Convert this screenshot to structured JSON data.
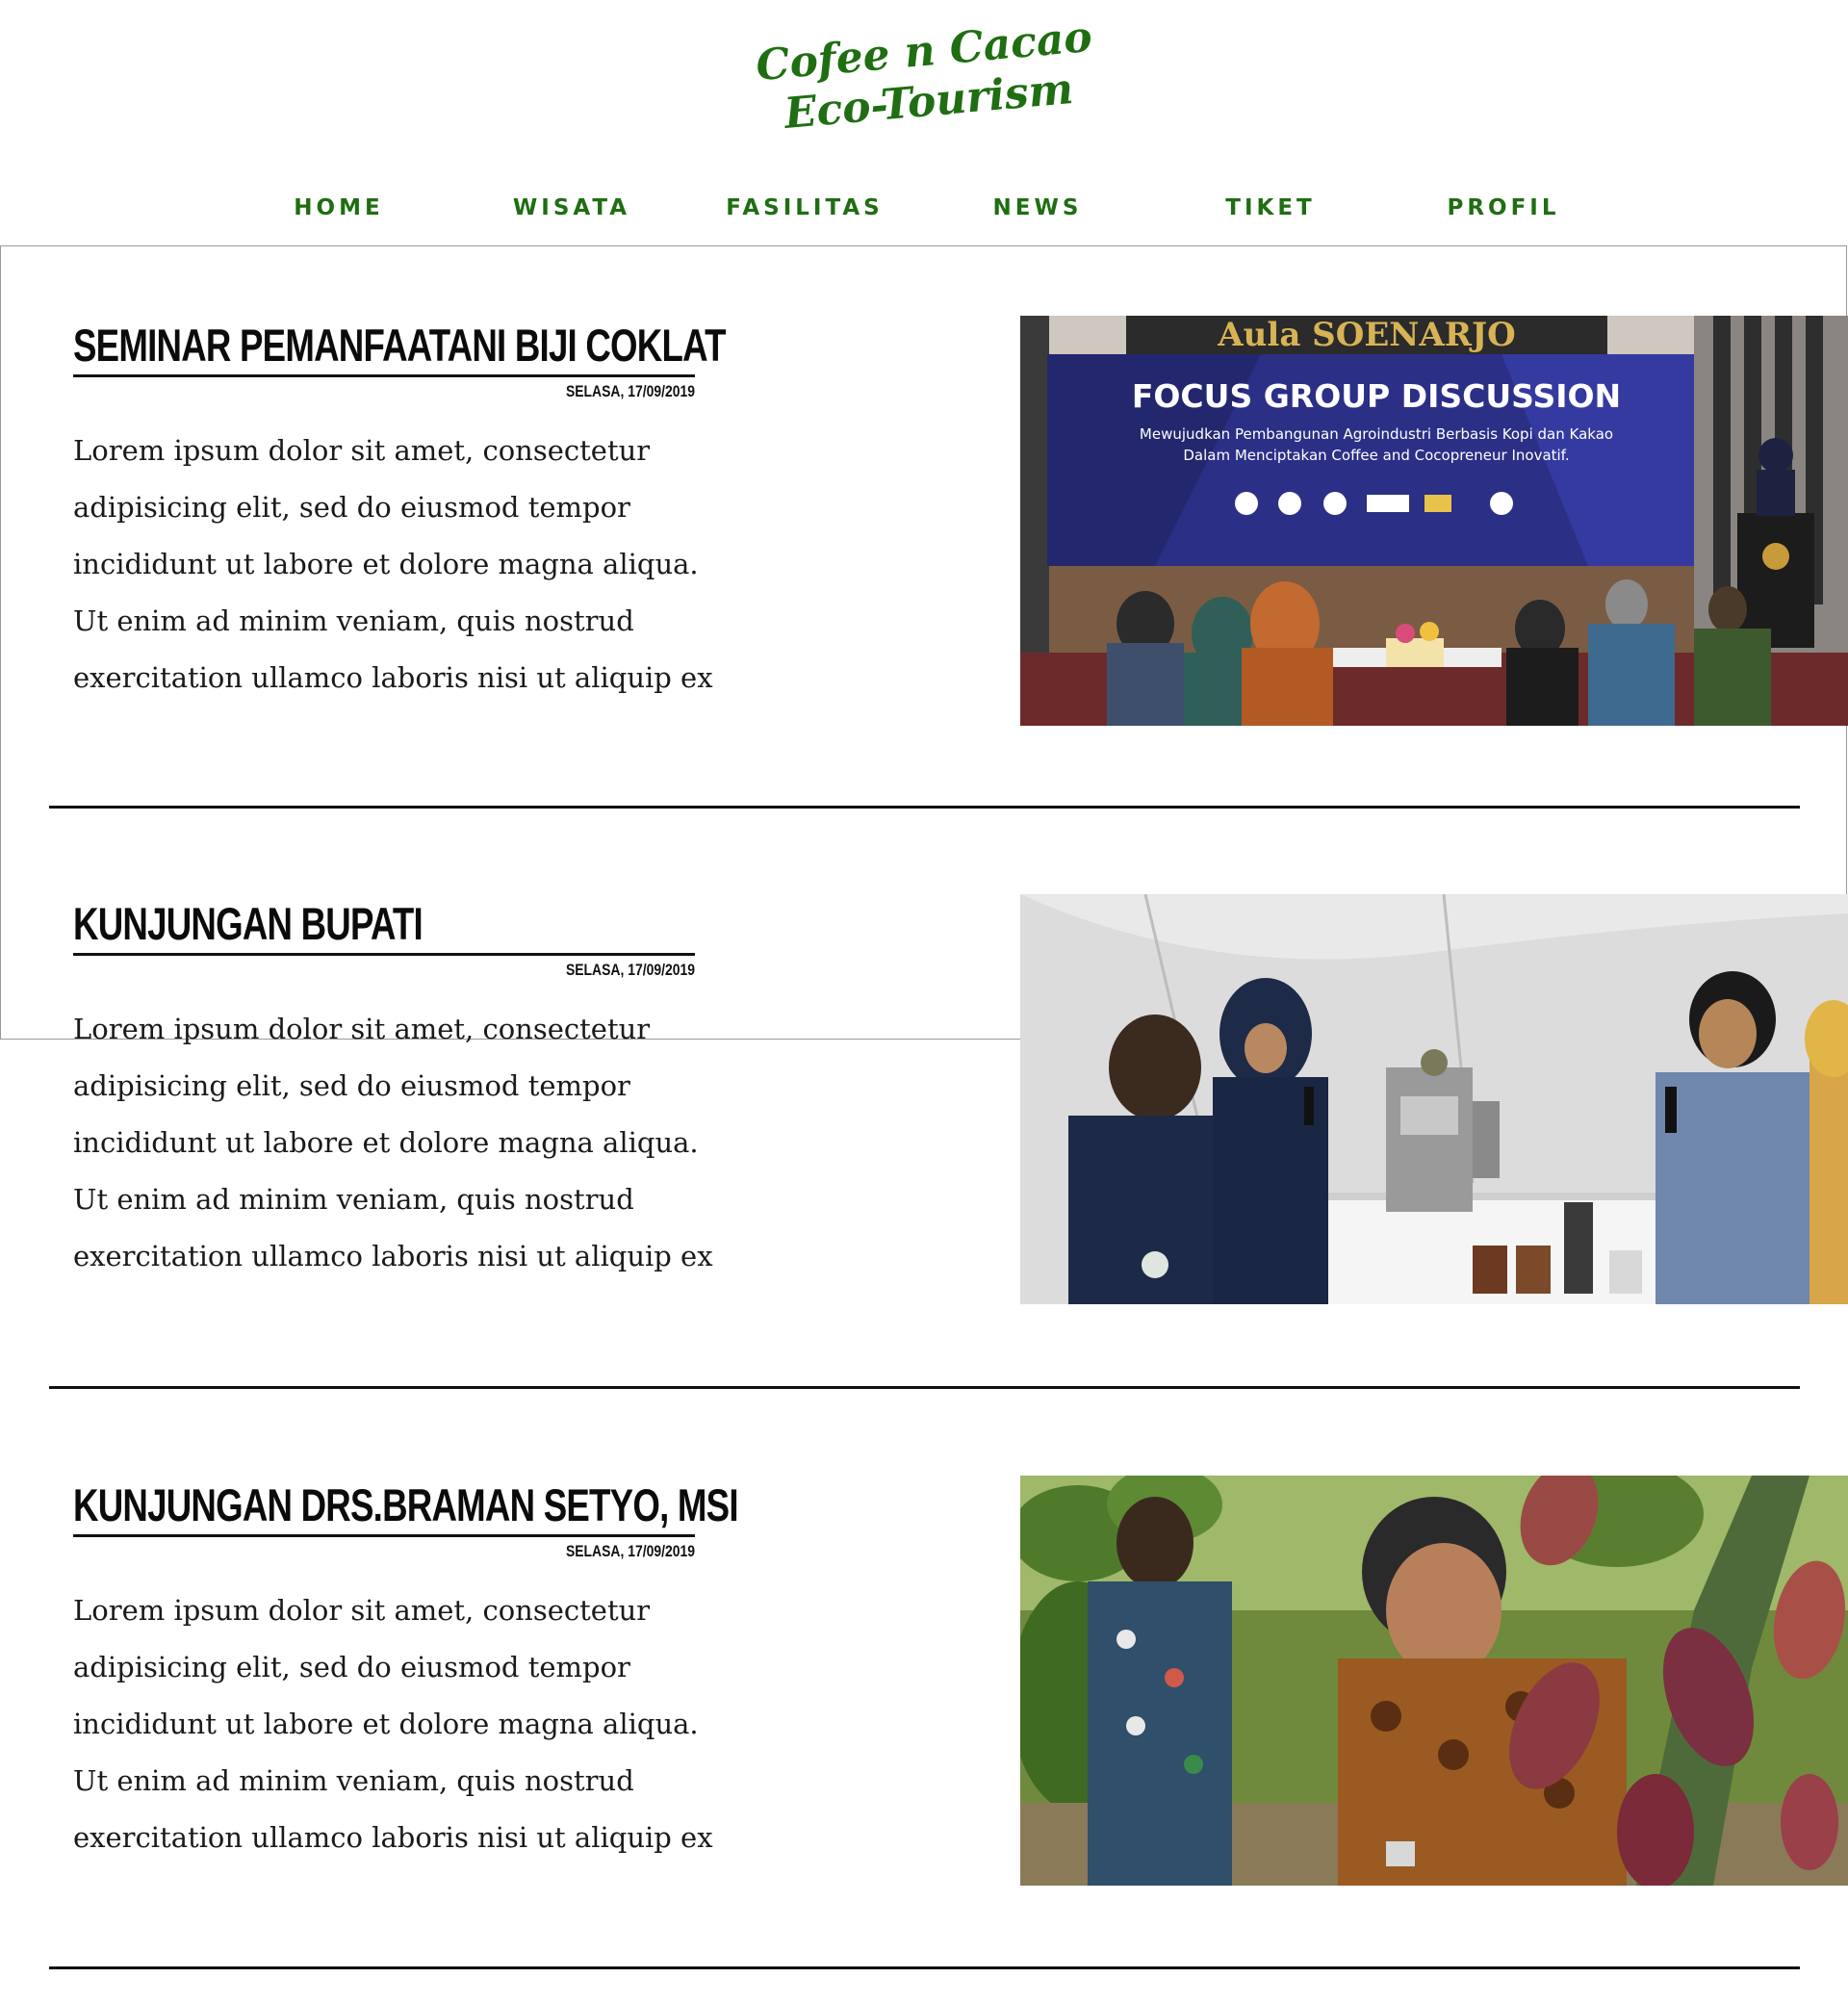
{
  "brand": {
    "line1": "Cofee n Cacao",
    "line2": "Eco-Tourism"
  },
  "nav": [
    {
      "label": "HOME"
    },
    {
      "label": "WISATA"
    },
    {
      "label": "FASILITAS"
    },
    {
      "label": "NEWS"
    },
    {
      "label": "TIKET"
    },
    {
      "label": "PROFIL"
    }
  ],
  "articles": [
    {
      "title": "SEMINAR PEMANFAATANI BIJI COKLAT",
      "date": "SELASA, 17/09/2019",
      "body": [
        "Lorem ipsum dolor sit amet, consectetur",
        "adipisicing elit, sed do eiusmod tempor",
        "incididunt ut labore et dolore magna aliqua.",
        "Ut enim ad minim veniam, quis nostrud",
        "exercitation ullamco laboris nisi ut aliquip ex"
      ],
      "photo": {
        "hall_sign": "Aula SOENARJO",
        "banner_title": "FOCUS GROUP DISCUSSION",
        "banner_sub1": "Mewujudkan Pembangunan Agroindustri Berbasis Kopi dan Kakao",
        "banner_sub2": "Dalam Menciptakan Coffee and Cocopreneur Inovatif."
      }
    },
    {
      "title": "KUNJUNGAN BUPATI",
      "date": "SELASA, 17/09/2019",
      "body": [
        "Lorem ipsum dolor sit amet, consectetur",
        "adipisicing elit, sed do eiusmod tempor",
        "incididunt ut labore et dolore magna aliqua.",
        "Ut enim ad minim veniam, quis nostrud",
        "exercitation ullamco laboris nisi ut aliquip ex"
      ]
    },
    {
      "title": "KUNJUNGAN DRS.BRAMAN SETYO, MSI",
      "date": "SELASA, 17/09/2019",
      "body": [
        "Lorem ipsum dolor sit amet, consectetur",
        "adipisicing elit, sed do eiusmod tempor",
        "incididunt ut labore et dolore magna aliqua.",
        "Ut enim ad minim veniam, quis nostrud",
        "exercitation ullamco laboris nisi ut aliquip ex"
      ]
    }
  ],
  "colors": {
    "brand_green": "#1f6e12",
    "text": "#111111"
  }
}
